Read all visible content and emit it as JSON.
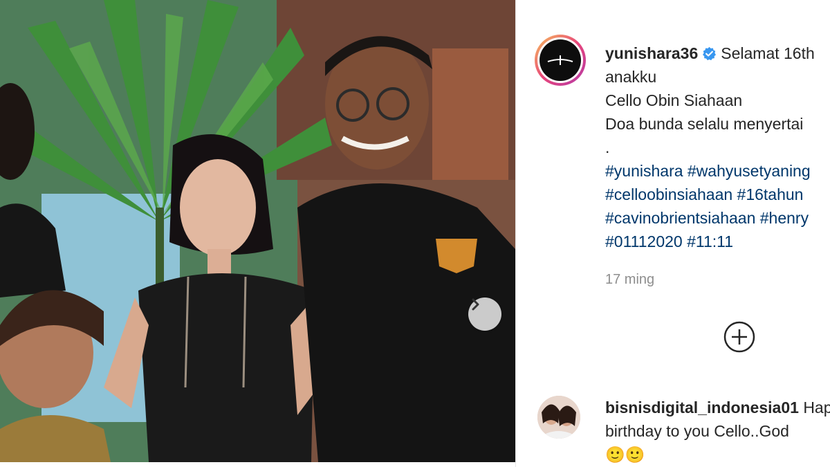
{
  "post": {
    "username": "yunishara36",
    "caption_lines": [
      "Selamat 16th",
      "anakku",
      "Cello Obin Siahaan",
      "Doa bunda selalu menyertai",
      "."
    ],
    "hashtag_lines": [
      "#yunishara #wahyusetyaning",
      "#celloobinsiahaan #16tahun",
      "#cavinobrientsiahaan #henry",
      "#01112020 #11:11"
    ],
    "timestamp": "17 ming"
  },
  "comment": {
    "username": "bisnisdigital_indonesia01",
    "line1_suffix": "Happy",
    "line2": "birthday to you Cello..God",
    "line3": "🙂🙂"
  },
  "icons": {
    "verified": "verified-badge-icon",
    "next": "chevron-right-icon",
    "add": "plus-circle-icon"
  },
  "colors": {
    "verified": "#3897f0",
    "hashtag": "#00376b",
    "meta_text": "#8e8e8e"
  }
}
